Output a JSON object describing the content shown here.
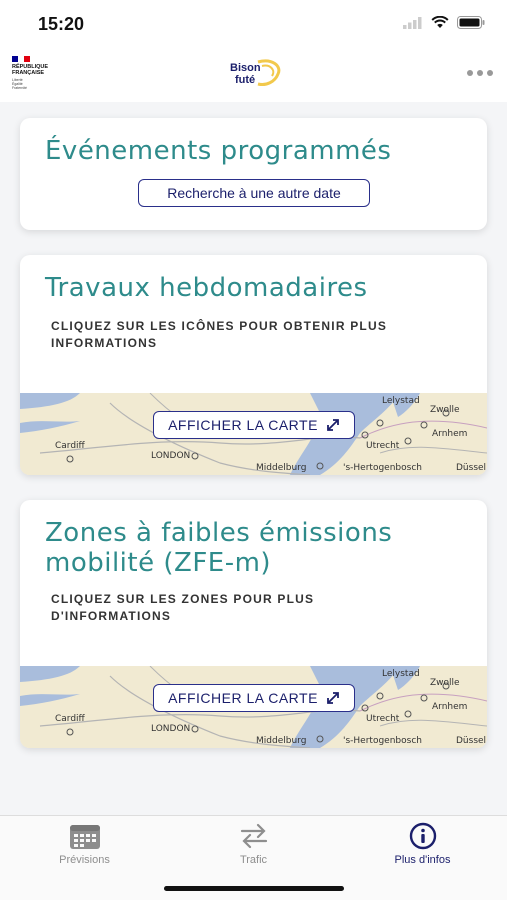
{
  "status": {
    "time": "15:20"
  },
  "header": {
    "gov_logo_text": [
      "RÉPUBLIQUE",
      "FRANÇAISE"
    ],
    "gov_motto": [
      "Liberté",
      "Égalité",
      "Fraternité"
    ],
    "brand_logo_text": [
      "Bison",
      "futé"
    ]
  },
  "cards": {
    "events": {
      "title": "Événements programmés",
      "button": "Recherche à une autre date"
    },
    "works": {
      "title": "Travaux hebdomadaires",
      "caption_line1": "CLIQUEZ SUR LES ICÔNES POUR OBTENIR PLUS",
      "caption_line2": "INFORMATIONS",
      "map_button": "AFFICHER LA CARTE"
    },
    "zfe": {
      "title_line1": "Zones à faibles émissions",
      "title_line2": "mobilité (ZFE-m)",
      "caption_line1": "CLIQUEZ SUR LES ZONES POUR PLUS",
      "caption_line2": "D'INFORMATIONS",
      "map_button": "AFFICHER LA CARTE"
    }
  },
  "map_labels": {
    "cardiff": "Cardiff",
    "london": "LONDON",
    "lelystad": "Lelystad",
    "zwolle": "Zwolle",
    "arnhem": "Arnhem",
    "utrecht": "Utrecht",
    "middelburg": "Middelburg",
    "hertogenbosch": "'s-Hertogenbosch",
    "dusseldorf": "Düssel"
  },
  "tabs": [
    {
      "label": "Prévisions",
      "icon": "calendar-icon",
      "active": false
    },
    {
      "label": "Trafic",
      "icon": "swap-arrows-icon",
      "active": false
    },
    {
      "label": "Plus d'infos",
      "icon": "info-icon",
      "active": true
    }
  ],
  "colors": {
    "accent_teal": "#2e8b8b",
    "navy": "#1b1f6b",
    "map_land": "#f1ead2",
    "map_water": "#a9bddc"
  }
}
